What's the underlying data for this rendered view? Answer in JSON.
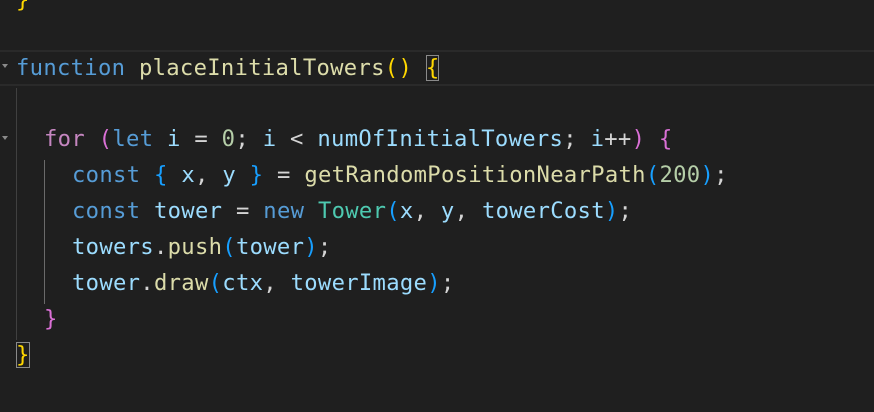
{
  "editor": {
    "language": "javascript",
    "theme_background": "#1f1f1f",
    "lines": [
      {
        "line": "top-brace",
        "text": "}"
      },
      {
        "line": "function-declaration",
        "text": "function placeInitialTowers() {"
      },
      {
        "line": "blank",
        "text": ""
      },
      {
        "line": "for-loop",
        "text": "for (let i = 0; i < numOfInitialTowers; i++) {"
      },
      {
        "line": "const-destructure",
        "text": "const { x, y } = getRandomPositionNearPath(200);"
      },
      {
        "line": "const-tower",
        "text": "const tower = new Tower(x, y, towerCost);"
      },
      {
        "line": "push-tower",
        "text": "towers.push(tower);"
      },
      {
        "line": "draw-tower",
        "text": "tower.draw(ctx, towerImage);"
      },
      {
        "line": "close-for",
        "text": "}"
      },
      {
        "line": "close-function",
        "text": "}"
      }
    ],
    "tokens": {
      "kw_function": "function",
      "fn_placeInitialTowers": "placeInitialTowers",
      "paren_open": "(",
      "paren_close": ")",
      "brace_open": "{",
      "brace_close": "}",
      "kw_for": "for",
      "kw_let": "let",
      "var_i": "i",
      "op_eq": "=",
      "num_0": "0",
      "semi": ";",
      "op_lt": "<",
      "var_numOfInitialTowers": "numOfInitialTowers",
      "op_inc": "++",
      "kw_const": "const",
      "var_x": "x",
      "var_y": "y",
      "comma": ",",
      "fn_getRandomPositionNearPath": "getRandomPositionNearPath",
      "num_200": "200",
      "var_tower": "tower",
      "kw_new": "new",
      "cls_Tower": "Tower",
      "var_towerCost": "towerCost",
      "var_towers": "towers",
      "dot": ".",
      "fn_push": "push",
      "fn_draw": "draw",
      "var_ctx": "ctx",
      "var_towerImage": "towerImage"
    }
  }
}
